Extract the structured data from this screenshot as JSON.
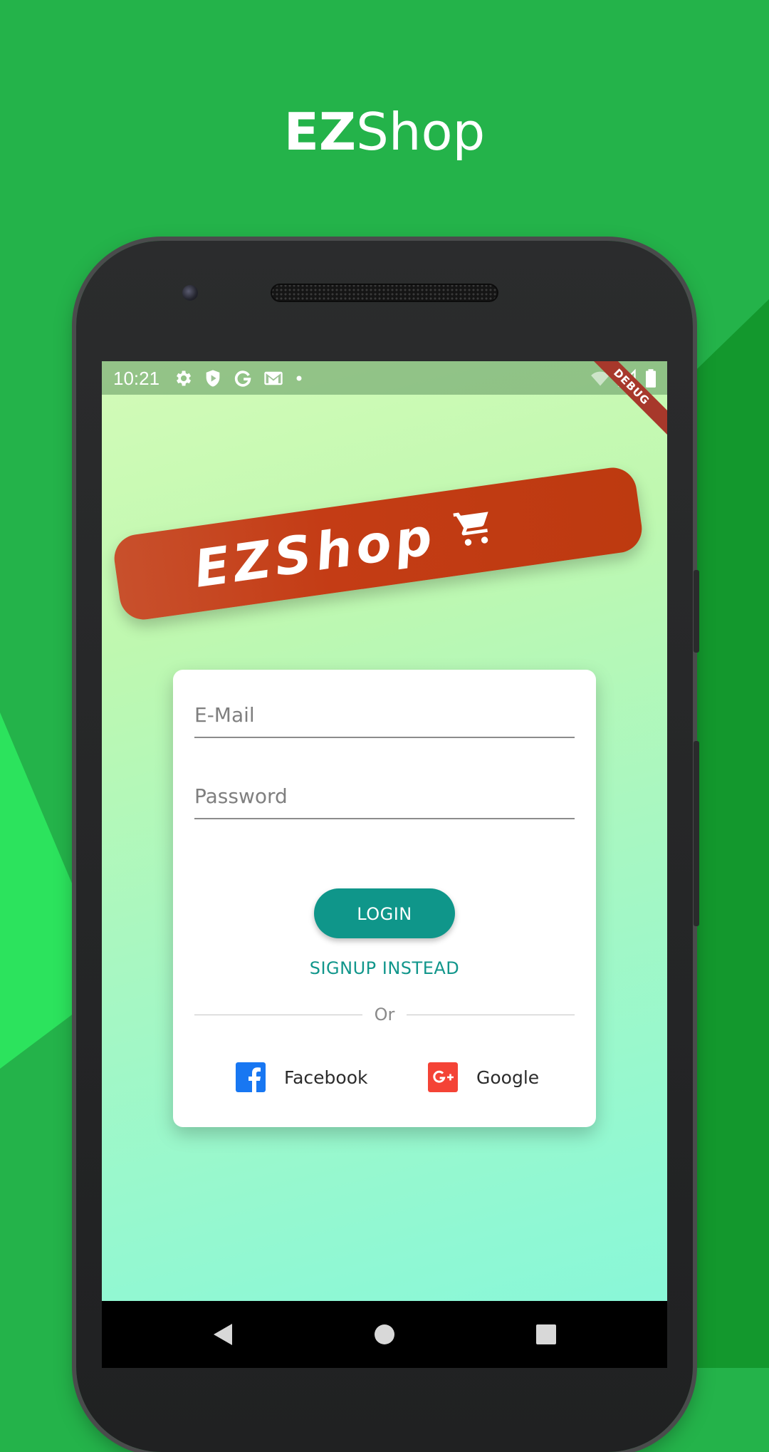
{
  "promo": {
    "title_bold": "EZ",
    "title_light": "Shop"
  },
  "status_bar": {
    "time": "10:21"
  },
  "debug_banner": {
    "label": "DEBUG"
  },
  "logo": {
    "text": "EZShop",
    "icon": "shopping-cart-icon"
  },
  "login_form": {
    "email_placeholder": "E-Mail",
    "email_value": "",
    "password_placeholder": "Password",
    "password_value": "",
    "login_label": "LOGIN",
    "signup_label": "SIGNUP INSTEAD",
    "divider_label": "Or",
    "facebook_label": "Facebook",
    "google_label": "Google"
  },
  "colors": {
    "background": "#24b34a",
    "accent": "#0f968a",
    "logo_banner": "#c43c15",
    "facebook": "#1877f2",
    "google": "#f44336"
  }
}
